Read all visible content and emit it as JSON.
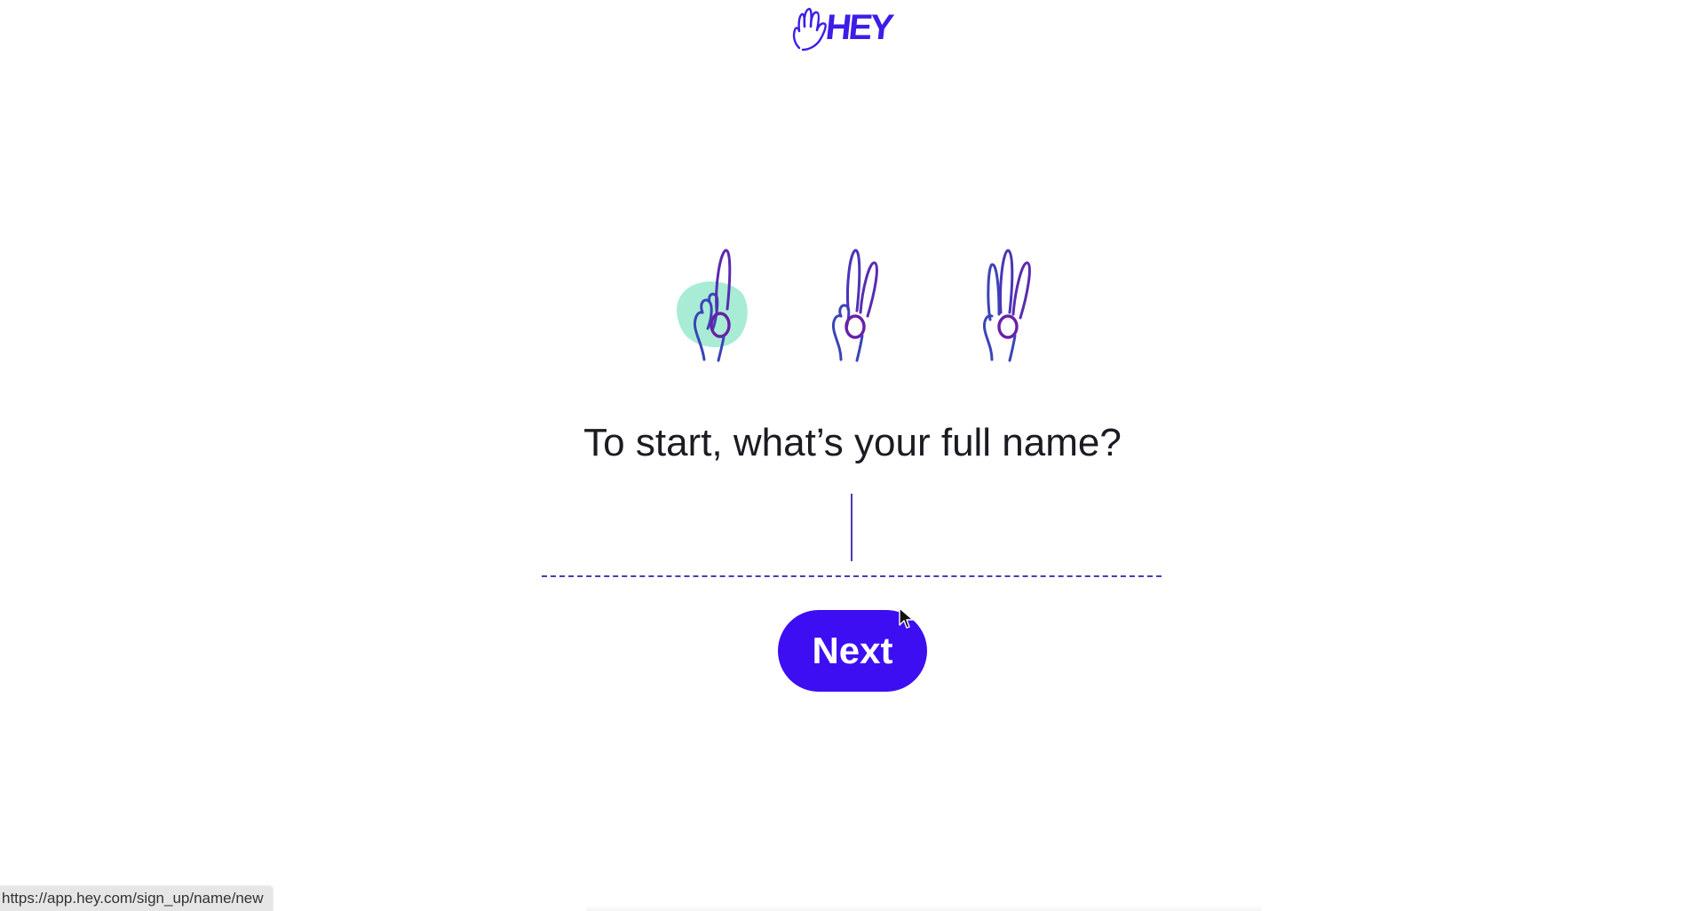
{
  "brand": {
    "logo_text": "HEY",
    "accent_color": "#3d0ef2",
    "logo_color": "#3d1de8",
    "highlight_color": "#a8ecd6"
  },
  "icons": {
    "logo": "waving-hand-icon",
    "step_1": "one-finger-hand-icon",
    "step_2": "two-fingers-hand-icon",
    "step_3": "three-fingers-hand-icon",
    "pointer": "mouse-pointer-icon"
  },
  "steps": {
    "current": 1,
    "total": 3
  },
  "form": {
    "question": "To start, what’s your full name?",
    "name_value": "",
    "name_placeholder": "",
    "next_label": "Next"
  },
  "status_bar": {
    "url": "https://app.hey.com/sign_up/name/new"
  }
}
